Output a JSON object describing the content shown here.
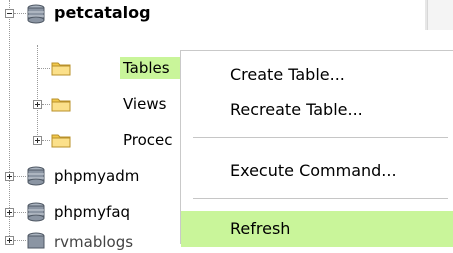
{
  "tree": {
    "root": {
      "label": "petcatalog",
      "expanded": true,
      "icon": "database-icon"
    },
    "children": [
      {
        "label": "Tables",
        "icon": "folder-icon",
        "selected": true
      },
      {
        "label": "Views",
        "icon": "folder-icon",
        "expanded": false
      },
      {
        "label": "Procec",
        "icon": "folder-icon",
        "expanded": false
      }
    ],
    "siblings": [
      {
        "label": "phpmyadm",
        "icon": "database-icon"
      },
      {
        "label": "phpmyfaq",
        "icon": "database-icon"
      },
      {
        "label": "rvmablogs",
        "icon": "database-icon"
      }
    ]
  },
  "context_menu": {
    "items": [
      {
        "label": "Create Table..."
      },
      {
        "label": "Recreate Table..."
      },
      {
        "label": "Execute Command..."
      },
      {
        "label": "Refresh",
        "highlighted": true
      }
    ]
  },
  "colors": {
    "selection": "#c9f59a",
    "folder": "#f2c84b",
    "database": "#7f8a99"
  }
}
